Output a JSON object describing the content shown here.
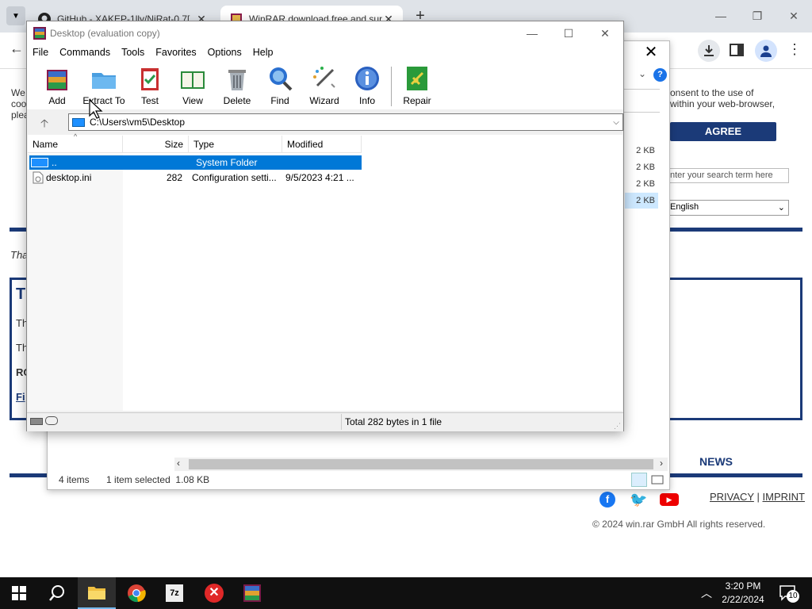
{
  "browser": {
    "tabs": [
      {
        "title": "GitHub - XAKEP-1lly/NjRat-0.7[",
        "close": "✕"
      },
      {
        "title": "WinRAR download free and sup",
        "close": "✕"
      }
    ],
    "new_tab": "+",
    "window_controls": {
      "minimize": "—",
      "restore": "❐",
      "close": "✕"
    },
    "back": "←"
  },
  "page": {
    "left_text": "We\ncoo\nplea",
    "consent": "onsent to the use of\nwithin your web-browser,",
    "agree": "AGREE",
    "search_placeholder": "nter your search term here",
    "language": "English",
    "tha": "Tha",
    "box_lines": [
      "T",
      "Th",
      "Th",
      "RO",
      "Fi"
    ],
    "news": "NEWS",
    "privacy": "PRIVACY",
    "separator": "|",
    "imprint": "IMPRINT",
    "copyright": "© 2024 win.rar GmbH All rights reserved."
  },
  "explorer_bg": {
    "close": "✕",
    "sizes": [
      "2 KB",
      "2 KB",
      "2 KB",
      "2 KB"
    ],
    "status_items": "4 items",
    "status_selected": "1 item selected  1.08 KB"
  },
  "winrar": {
    "title": "Desktop (evaluation copy)",
    "menu": [
      "File",
      "Commands",
      "Tools",
      "Favorites",
      "Options",
      "Help"
    ],
    "toolbar": [
      "Add",
      "Extract To",
      "Test",
      "View",
      "Delete",
      "Find",
      "Wizard",
      "Info",
      "Repair"
    ],
    "address": "C:\\Users\\vm5\\Desktop",
    "columns": [
      "Name",
      "Size",
      "Type",
      "Modified"
    ],
    "rows": [
      {
        "name": "..",
        "size": "",
        "type": "System Folder",
        "modified": "",
        "selected": true
      },
      {
        "name": "desktop.ini",
        "size": "282",
        "type": "Configuration setti...",
        "modified": "9/5/2023 4:21 ...",
        "selected": false
      }
    ],
    "status": "Total 282 bytes in 1 file"
  },
  "taskbar": {
    "time": "3:20 PM",
    "date": "2/22/2024",
    "notifications": "10"
  }
}
